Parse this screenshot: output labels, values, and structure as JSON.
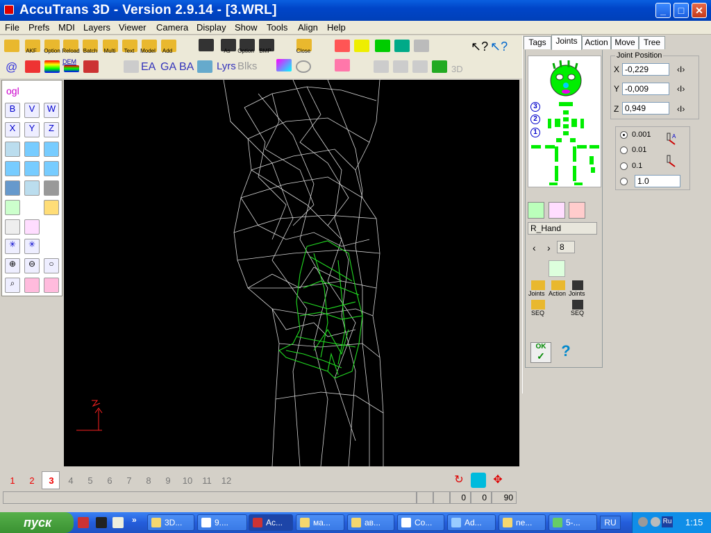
{
  "window": {
    "title": "AccuTrans 3D - Version 2.9.14 - [3.WRL]",
    "minimize": "_",
    "maximize": "□",
    "close": "✕"
  },
  "menu": [
    "File",
    "Prefs",
    "MDI",
    "Layers",
    "Viewer",
    "Camera",
    "Display",
    "Show",
    "Tools",
    "Align",
    "Help"
  ],
  "toolbar": {
    "labels": [
      "AKF",
      "Option",
      "Reload",
      "Batch",
      "Multi",
      "Text",
      "Model",
      "Add",
      "As",
      "Option",
      "BMP",
      "Close"
    ],
    "row2_text": [
      "EA",
      "GA",
      "BA",
      "Lyrs",
      "Blks",
      "3D"
    ],
    "dem": "DEM"
  },
  "left_tools": {
    "ogl": "ogl",
    "axis_labels": [
      "B",
      "V",
      "W",
      "X",
      "Y",
      "Z"
    ]
  },
  "pages": [
    "1",
    "2",
    "3",
    "4",
    "5",
    "6",
    "7",
    "8",
    "9",
    "10",
    "11",
    "12"
  ],
  "active_page": "3",
  "status": {
    "values": [
      "0",
      "0",
      "90"
    ]
  },
  "right_panel": {
    "tabs": [
      "Tags",
      "Joints",
      "Action",
      "Move",
      "Tree"
    ],
    "active_tab": "Joints",
    "joint_position_label": "Joint Position",
    "x_label": "X",
    "x_value": "-0,229",
    "y_label": "Y",
    "y_value": "-0,009",
    "z_label": "Z",
    "z_value": "0,949",
    "step_options": [
      "0.001",
      "0.01",
      "0.1"
    ],
    "step_custom": "1.0",
    "selected_step": "0.001",
    "badges": [
      "3",
      "2",
      "1"
    ],
    "joint_name": "R_Hand",
    "joint_index": "8",
    "file_labels": [
      "Joints",
      "Action",
      "Joints",
      "SEQ",
      "SEQ"
    ],
    "ok": "OK",
    "help": "?"
  },
  "taskbar": {
    "start": "пуск",
    "tasks": [
      "3D...",
      "9....",
      "Ac...",
      "ма...",
      "ав...",
      "Co...",
      "Ad...",
      "ne...",
      "5-..."
    ],
    "lang": "RU",
    "tray_lang": "Ru",
    "clock": "1:15"
  },
  "colors": {
    "wire_white": "#d8d8d8",
    "wire_green": "#22dd22",
    "title_blue": "#0a5fe0",
    "accent_green": "#00ee00"
  }
}
